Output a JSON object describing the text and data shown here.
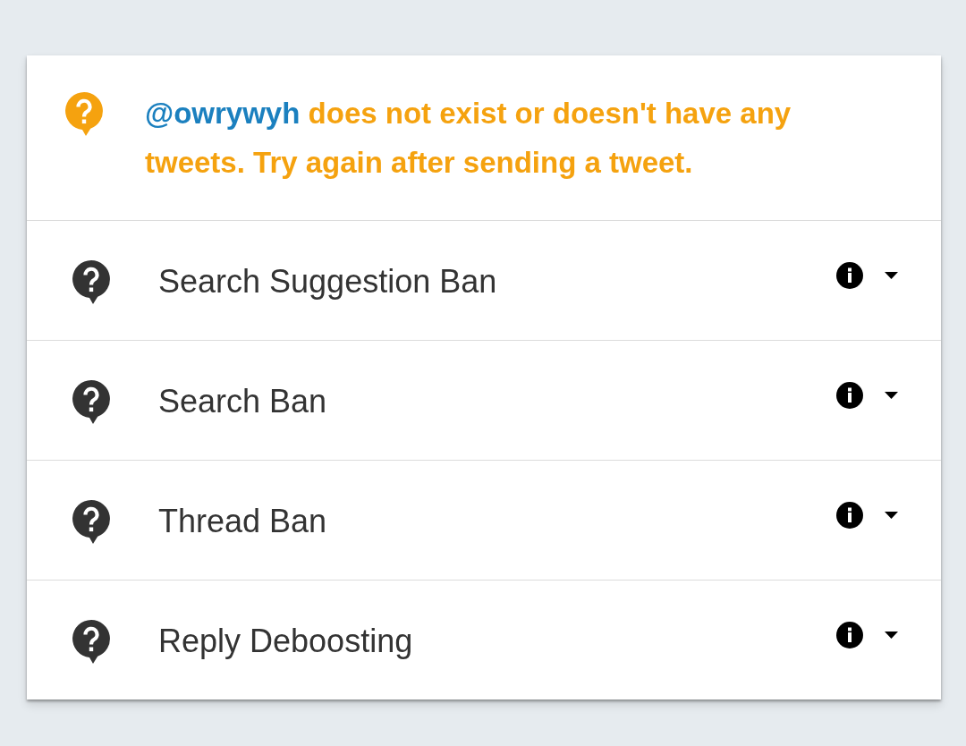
{
  "notice": {
    "kind": "warning",
    "handle": "@owrywyh",
    "message": "does not exist or doesn't have any tweets. Try again after sending a tweet."
  },
  "checks": [
    {
      "label": "Search Suggestion Ban",
      "kind": "unknown",
      "expanded": false
    },
    {
      "label": "Search Ban",
      "kind": "unknown",
      "expanded": false
    },
    {
      "label": "Thread Ban",
      "kind": "unknown",
      "expanded": false
    },
    {
      "label": "Reply Deboosting",
      "kind": "unknown",
      "expanded": false
    }
  ]
}
